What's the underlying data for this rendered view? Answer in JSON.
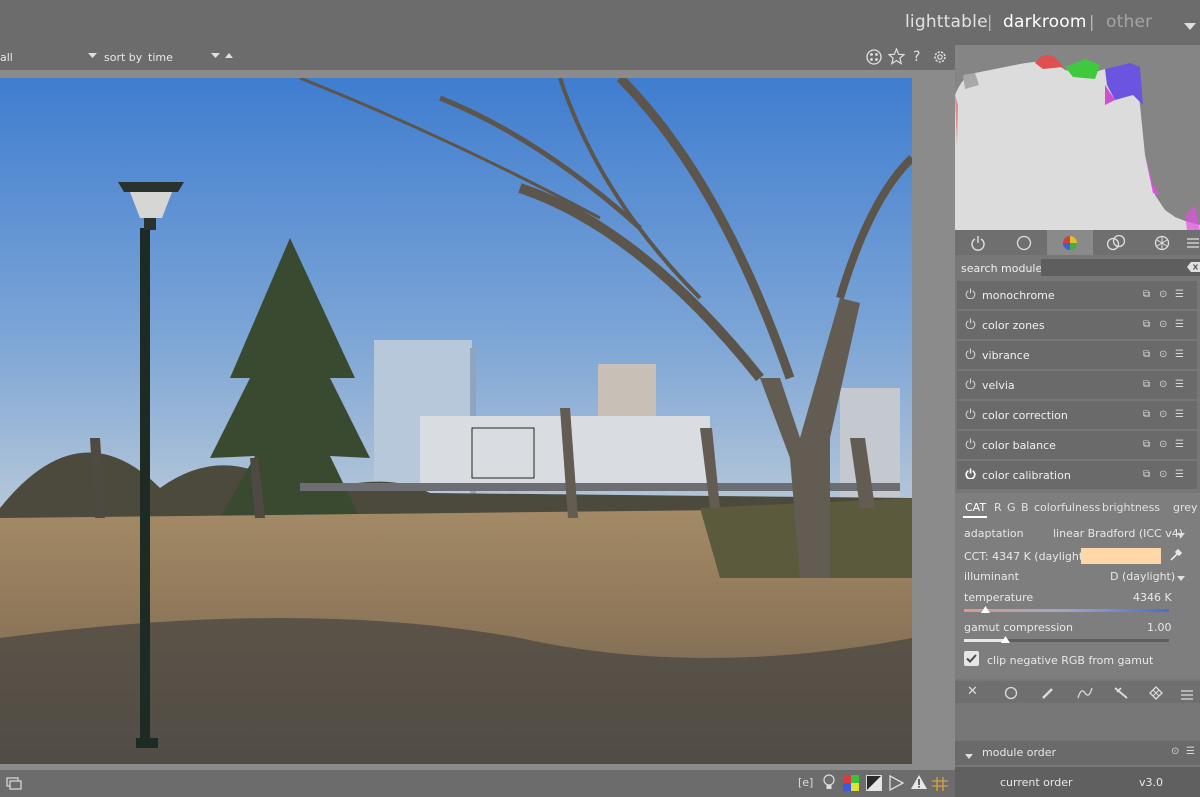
{
  "header": {
    "views": [
      {
        "label": "lighttable",
        "state": "normal"
      },
      {
        "label": "darkroom",
        "state": "active"
      },
      {
        "label": "other",
        "state": "dim"
      }
    ],
    "separator": "|",
    "menu_icon": "triangle-down-icon"
  },
  "filterbar": {
    "filter_value": "all",
    "sort_label": "sort by",
    "sort_value": "time",
    "icons": [
      "grid-icon",
      "star-icon",
      "help-icon",
      "gear-icon"
    ]
  },
  "right_panel": {
    "tabs": [
      "power-icon",
      "circle-icon",
      "color-wheel-icon",
      "correct-icon",
      "effect-icon",
      "menu-icon"
    ],
    "active_tab": 2,
    "search_label": "search module",
    "search_value": "",
    "modules": [
      {
        "name": "monochrome",
        "enabled": false
      },
      {
        "name": "color zones",
        "enabled": false
      },
      {
        "name": "vibrance",
        "enabled": false
      },
      {
        "name": "velvia",
        "enabled": false
      },
      {
        "name": "color correction",
        "enabled": false
      },
      {
        "name": "color balance",
        "enabled": false
      },
      {
        "name": "color calibration",
        "enabled": true
      }
    ],
    "calibration": {
      "tabs": [
        "CAT",
        "R",
        "G",
        "B",
        "colorfulness",
        "brightness",
        "grey"
      ],
      "active_tab": "CAT",
      "adaptation_label": "adaptation",
      "adaptation_value": "linear Bradford (ICC v4)",
      "cct_label": "CCT: 4347 K (daylight)",
      "cct_swatch": "#ffd7a8",
      "illuminant_label": "illuminant",
      "illuminant_value": "D (daylight)",
      "temperature_label": "temperature",
      "temperature_value": "4346 K",
      "temperature_fraction": 0.1,
      "gamut_label": "gamut compression",
      "gamut_value": "1.00",
      "gamut_fraction": 0.2,
      "clip_label": "clip negative RGB from gamut",
      "clip_checked": true
    },
    "mask_icons": [
      "close-icon",
      "circle-icon",
      "brush-icon",
      "curve-icon",
      "pen-icon",
      "mask-grid-icon",
      "menu-icon"
    ],
    "module_order": {
      "title": "module order",
      "current_label": "current order",
      "current_value": "v3.0"
    }
  },
  "bottombar": {
    "icons": [
      "display-icon",
      "focus-peaking-icon",
      "lightbulb-icon",
      "color-assess-icon",
      "softproof-icon",
      "gamut-icon",
      "warning-icon",
      "guides-icon"
    ]
  },
  "colors": {
    "bg": "#6c6c6c",
    "panel": "#777777",
    "sky": "#5b8fd0",
    "ground": "#917a5c",
    "accent": "#ffd7a8"
  }
}
